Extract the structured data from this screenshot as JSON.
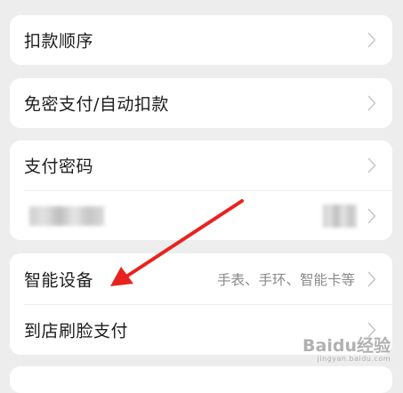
{
  "settings": {
    "deduction_order": {
      "label": "扣款顺序"
    },
    "password_free": {
      "label": "免密支付/自动扣款"
    },
    "payment_password": {
      "label": "支付密码"
    },
    "smart_device": {
      "label": "智能设备",
      "value": "手表、手环、智能卡等"
    },
    "face_pay": {
      "label": "到店刷脸支付"
    }
  },
  "watermark": {
    "text": "Baidu经验",
    "sub": "jingyan.baidu.com"
  },
  "colors": {
    "background": "#ededed",
    "card": "#ffffff",
    "text": "#1c1c1c",
    "secondary_text": "#8a8a8a",
    "chevron": "#c7c7c7",
    "annotation_arrow": "#e8231f"
  },
  "icons": [
    "chevron-right-icon"
  ]
}
